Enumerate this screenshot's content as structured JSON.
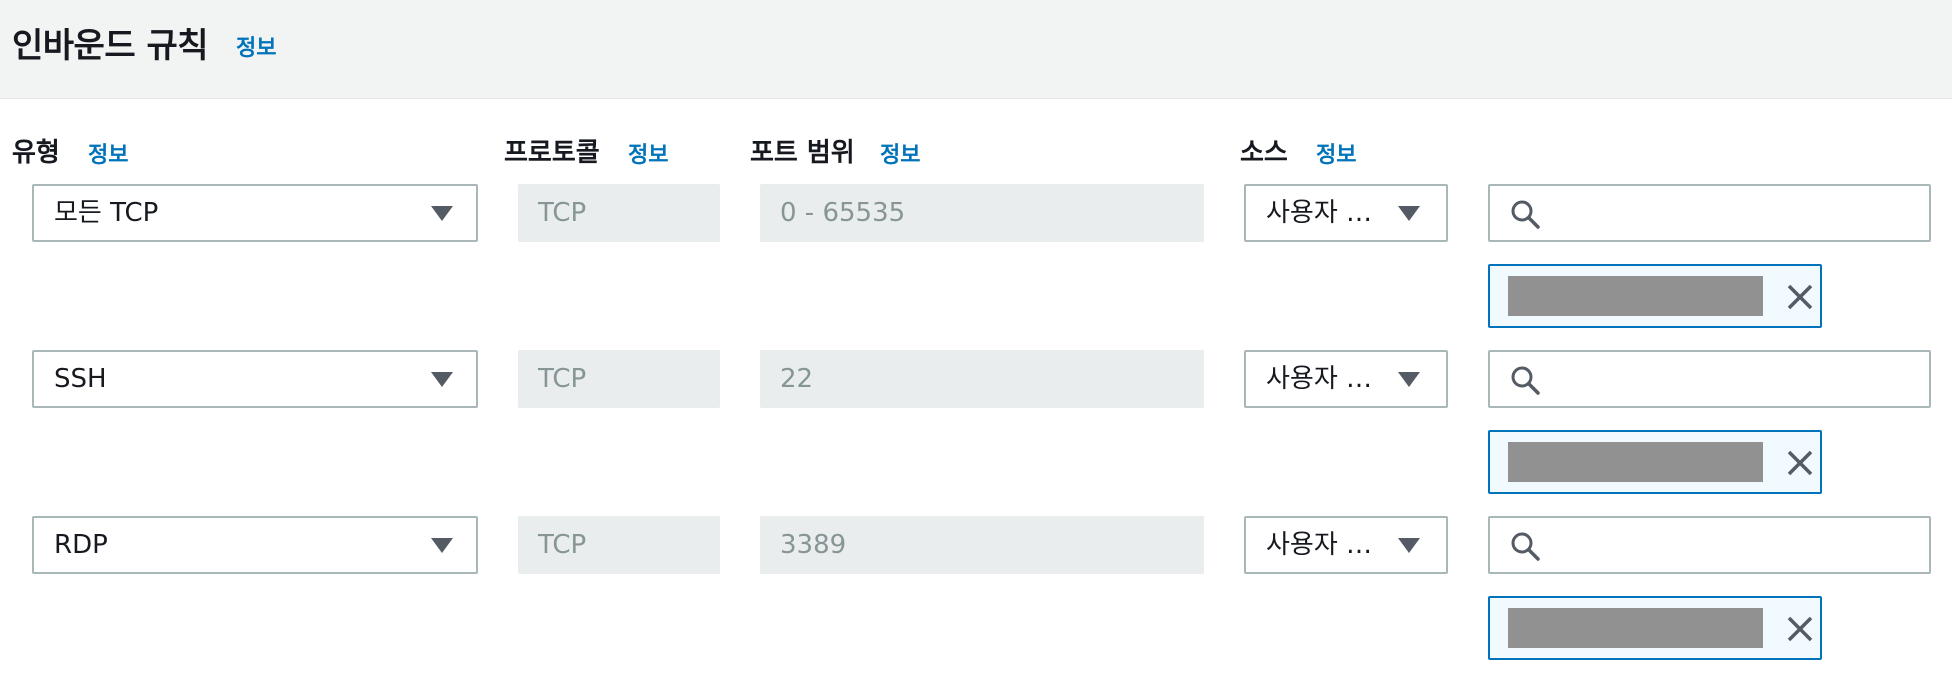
{
  "header": {
    "title": "인바운드 규칙",
    "info": "정보"
  },
  "columns": {
    "type": {
      "label": "유형",
      "info": "정보"
    },
    "protocol": {
      "label": "프로토콜",
      "info": "정보"
    },
    "port_range": {
      "label": "포트 범위",
      "info": "정보"
    },
    "source": {
      "label": "소스",
      "info": "정보"
    }
  },
  "rules": [
    {
      "type": "모든 TCP",
      "protocol": "TCP",
      "port_range": "0 - 65535",
      "source_type": "사용자 …",
      "search_value": ""
    },
    {
      "type": "SSH",
      "protocol": "TCP",
      "port_range": "22",
      "source_type": "사용자 …",
      "search_value": ""
    },
    {
      "type": "RDP",
      "protocol": "TCP",
      "port_range": "3389",
      "source_type": "사용자 …",
      "search_value": ""
    }
  ],
  "icons": {
    "search": "search-icon",
    "dropdown": "caret-down-icon",
    "remove": "close-icon"
  },
  "colors": {
    "link": "#0073bb",
    "token_border": "#0073bb",
    "token_bg": "#f1faff",
    "disabled_bg": "#eaeded"
  }
}
